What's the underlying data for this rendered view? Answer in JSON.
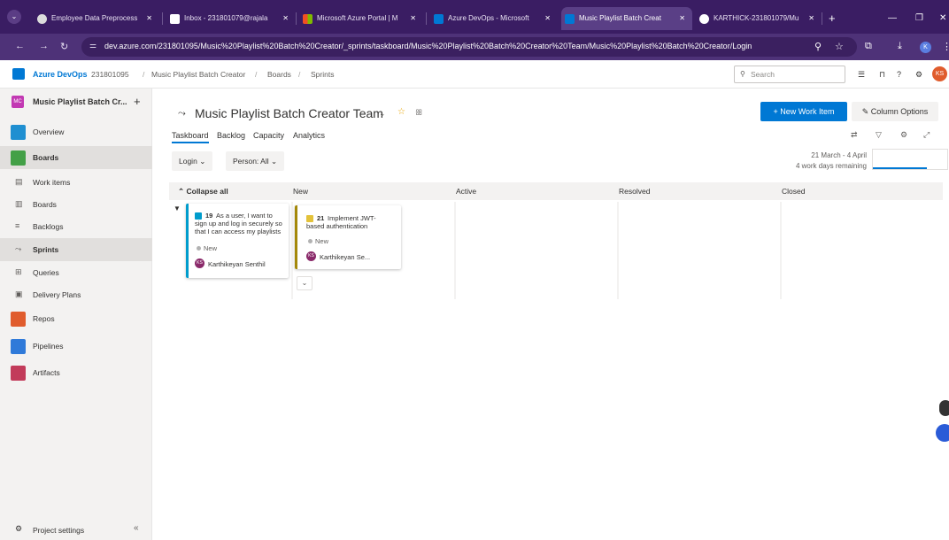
{
  "browser": {
    "tabs": [
      {
        "title": "Employee Data Preprocess",
        "color": "#5a5a5a"
      },
      {
        "title": "Inbox - 231801079@rajala",
        "color": "#d93025"
      },
      {
        "title": "Microsoft Azure Portal | M",
        "color": "#f25022"
      },
      {
        "title": "Azure DevOps - Microsoft",
        "color": "#0078d4"
      },
      {
        "title": "Music Playlist Batch Creat",
        "color": "#0078d4",
        "active": true
      },
      {
        "title": "KARTHICK-231801079/Mu",
        "color": "#ffffff"
      }
    ],
    "url": "dev.azure.com/231801095/Music%20Playlist%20Batch%20Creator/_sprints/taskboard/Music%20Playlist%20Batch%20Creator%20Team/Music%20Playlist%20Batch%20Creator/Login",
    "profile_initial": "K"
  },
  "header": {
    "brand": "Azure DevOps",
    "org": "231801095",
    "crumbs": [
      "Music Playlist Batch Creator",
      "Boards",
      "Sprints"
    ],
    "search_placeholder": "Search",
    "avatar_initials": "KS"
  },
  "sidebar": {
    "project_badge": "MC",
    "project_name": "Music Playlist Batch Cr...",
    "items": [
      {
        "label": "Overview",
        "color": "#1f8fd1"
      },
      {
        "label": "Boards",
        "color": "#43a047"
      },
      {
        "label": "Work items"
      },
      {
        "label": "Boards"
      },
      {
        "label": "Backlogs"
      },
      {
        "label": "Sprints"
      },
      {
        "label": "Queries"
      },
      {
        "label": "Delivery Plans"
      },
      {
        "label": "Repos",
        "color": "#e05c2d"
      },
      {
        "label": "Pipelines",
        "color": "#2f7ad9"
      },
      {
        "label": "Artifacts",
        "color": "#c23b5a"
      }
    ],
    "settings_label": "Project settings"
  },
  "main": {
    "team_title": "Music Playlist Batch Creator Team",
    "new_work_item": "New Work Item",
    "column_options": "Column Options",
    "pivots": [
      "Taskboard",
      "Backlog",
      "Capacity",
      "Analytics"
    ],
    "filter_login": "Login",
    "filter_person": "Person: All",
    "sprint_dates": "21 March - 4 April",
    "sprint_remaining": "4 work days remaining",
    "sprint_progress": 0.73,
    "collapse_all": "Collapse all",
    "columns": [
      "New",
      "Active",
      "Resolved",
      "Closed"
    ]
  },
  "cards": {
    "story": {
      "id": "19",
      "title": "As a user, I want to sign up and log in securely so that I can access my playlists",
      "state": "New",
      "assignee": "Karthikeyan Senthil",
      "initials": "KS",
      "color": "#009ccc"
    },
    "task": {
      "id": "21",
      "title": "Implement JWT-based authentication",
      "state": "New",
      "assignee": "Karthikeyan Se...",
      "initials": "KS",
      "color": "#a4880a"
    }
  }
}
